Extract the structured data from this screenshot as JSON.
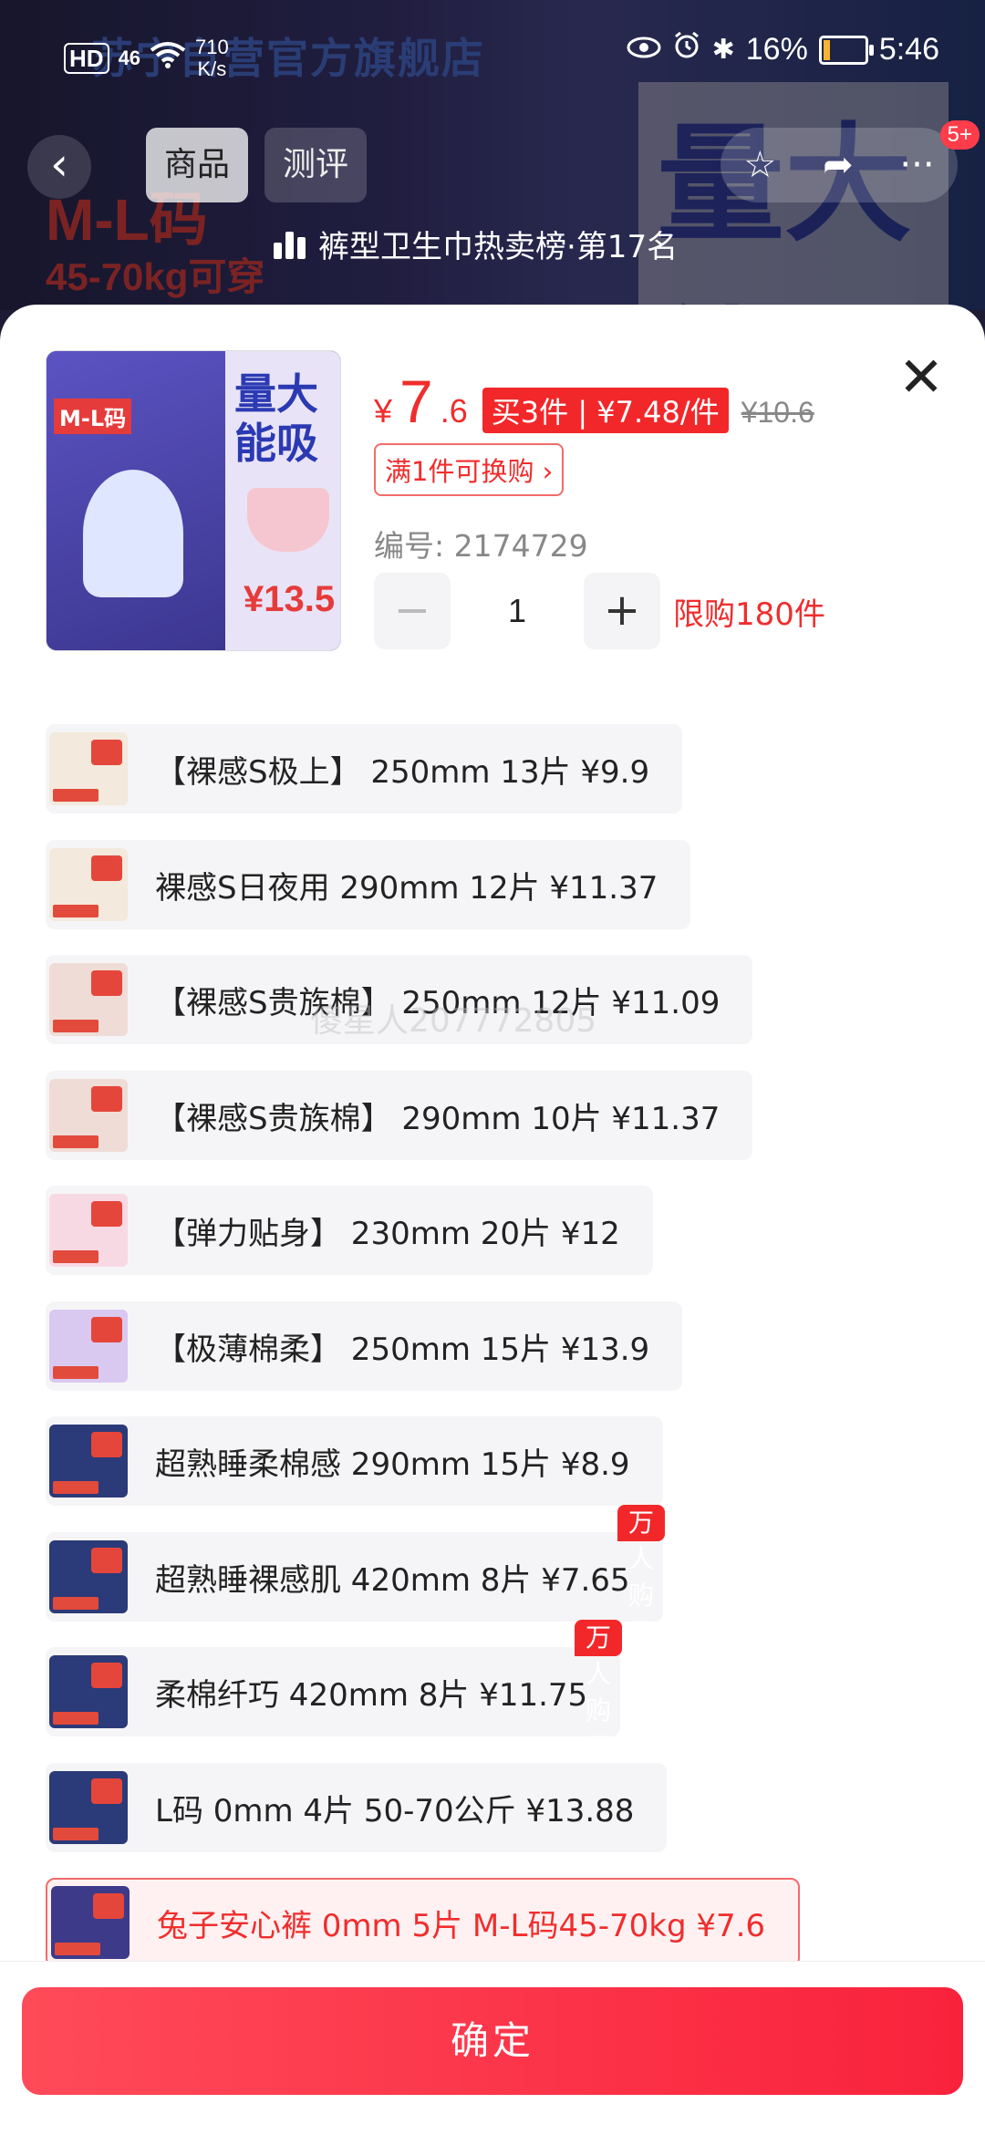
{
  "status_bar": {
    "network": "HD",
    "signal": "46",
    "speed_value": "710",
    "speed_unit": "K/s",
    "battery": "16%",
    "time": "5:46",
    "battery_level": 0.16
  },
  "background": {
    "store_name": "苏宁自营官方旗舰店",
    "banner_size": "M-L码",
    "banner_weight": "45-70kg可穿",
    "banner_big": "量大能吸"
  },
  "nav": {
    "back_icon": "chevron-left-icon",
    "tab_goods": "商品",
    "tab_review": "测评",
    "more_badge": "5+"
  },
  "rank": {
    "text": "裤型卫生巾热卖榜·第17名"
  },
  "product": {
    "image": {
      "size_tag": "M-L码",
      "big_text": "量大能吸",
      "price": "¥13.5"
    },
    "price_yen": "¥",
    "price_int": "7",
    "price_dec": ".6",
    "promo": "买3件 | ¥7.48/件",
    "original_price": "¥10.6",
    "exchange": "满1件可换购 ›",
    "sku": "编号: 2174729",
    "qty_minus": "−",
    "quantity": "1",
    "qty_plus": "+",
    "limit": "限购180件"
  },
  "variants": [
    {
      "label": "【裸感S极上】 250mm 13片  ¥9.9",
      "thumb_color": "#f3e9dc"
    },
    {
      "label": "裸感S日夜用 290mm 12片  ¥11.37",
      "thumb_color": "#f3e9dc"
    },
    {
      "label": "【裸感S贵族棉】 250mm 12片  ¥11.09",
      "thumb_color": "#f0dcd6"
    },
    {
      "label": "【裸感S贵族棉】 290mm 10片  ¥11.37",
      "thumb_color": "#f0dcd6"
    },
    {
      "label": "【弹力贴身】 230mm 20片  ¥12",
      "thumb_color": "#f7d9e4"
    },
    {
      "label": "【极薄棉柔】 250mm 15片  ¥13.9",
      "thumb_color": "#d9c8f0"
    },
    {
      "label": "超熟睡柔棉感 290mm 15片  ¥8.9",
      "thumb_color": "#2b3a78"
    },
    {
      "label": "超熟睡裸感肌 420mm 8片  ¥7.65",
      "thumb_color": "#2b3a78",
      "tag": "万人购买"
    },
    {
      "label": "柔棉纤巧 420mm 8片  ¥11.75",
      "thumb_color": "#2b3a78",
      "tag": "万人购买"
    },
    {
      "label": "L码 0mm 4片 50-70公斤  ¥13.88",
      "thumb_color": "#2b3a78"
    },
    {
      "label": "兔子安心裤 0mm 5片 M-L码45-70kg  ¥7.6",
      "thumb_color": "#3d3a8a",
      "selected": true
    }
  ],
  "watermark": "傻星人207772805",
  "confirm_button": "确定",
  "colors": {
    "accent": "#f02d2d",
    "confirm_start": "#ff4a59",
    "confirm_end": "#f9223c"
  }
}
